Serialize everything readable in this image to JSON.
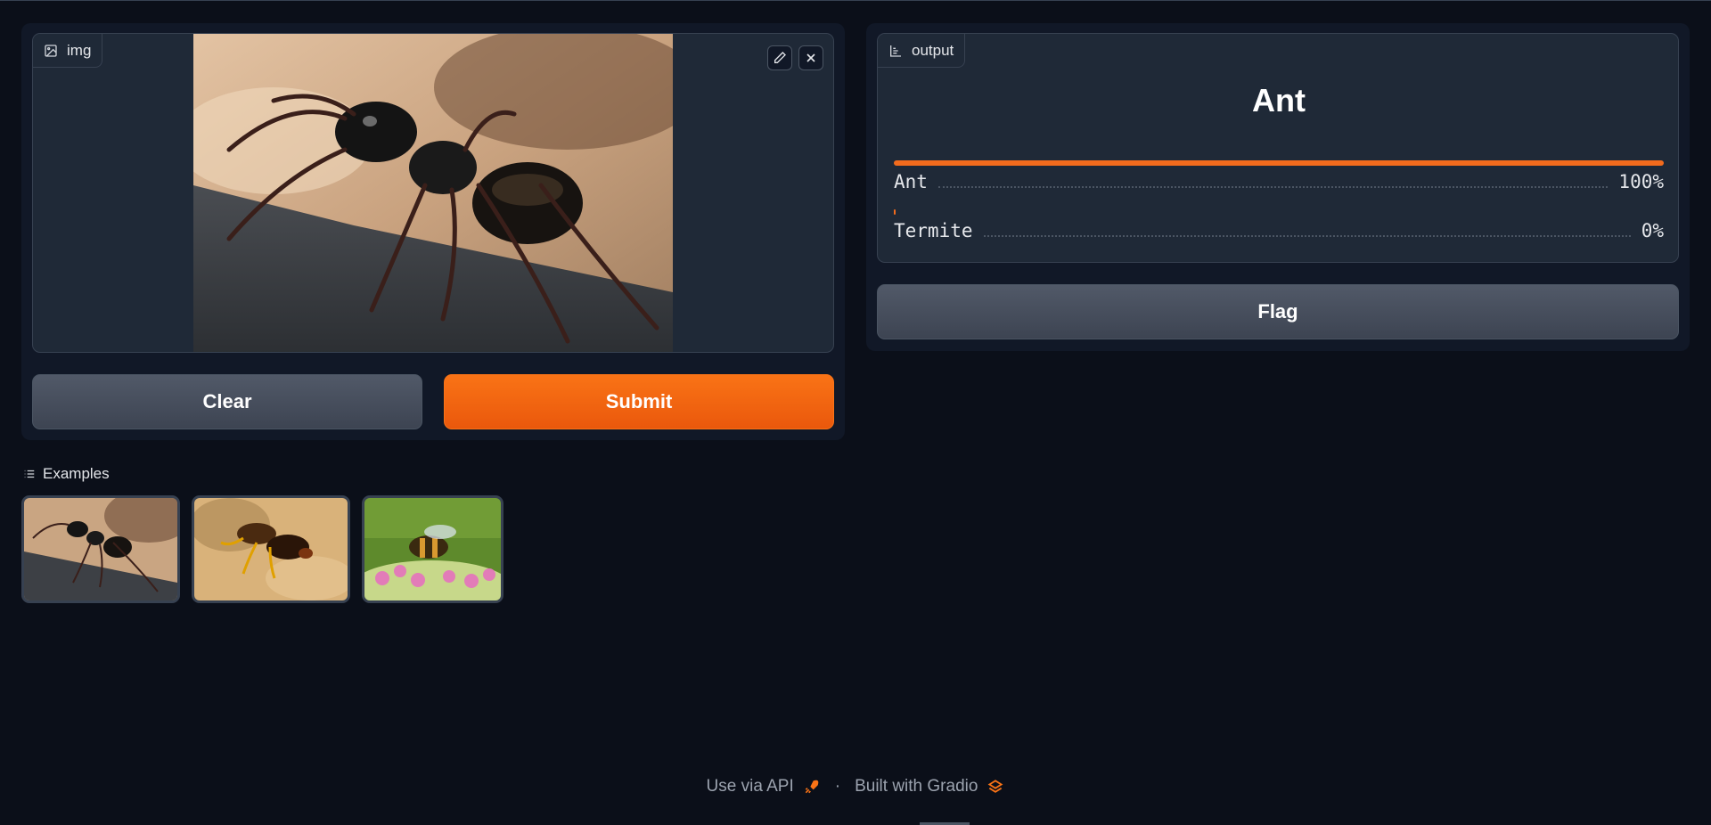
{
  "input": {
    "label": "img",
    "image_alt": "ant on dark rock"
  },
  "buttons": {
    "clear": "Clear",
    "submit": "Submit",
    "flag": "Flag"
  },
  "output": {
    "label": "output",
    "prediction": "Ant",
    "confidences": [
      {
        "label": "Ant",
        "value_text": "100%",
        "fraction": 1.0
      },
      {
        "label": "Termite",
        "value_text": "0%",
        "fraction": 0.0
      }
    ]
  },
  "examples": {
    "header": "Examples",
    "items": [
      {
        "subject": "ant"
      },
      {
        "subject": "termite"
      },
      {
        "subject": "bee"
      }
    ]
  },
  "footer": {
    "api_text": "Use via API",
    "separator": "·",
    "built_text": "Built with Gradio"
  },
  "colors": {
    "accent": "#f97316",
    "background": "#0b0f19",
    "panel": "#111827",
    "block": "#1f2937"
  },
  "icons": [
    "image-icon",
    "pencil-icon",
    "close-icon",
    "bar-chart-icon",
    "list-icon",
    "rocket-icon",
    "gradio-logo-icon"
  ]
}
